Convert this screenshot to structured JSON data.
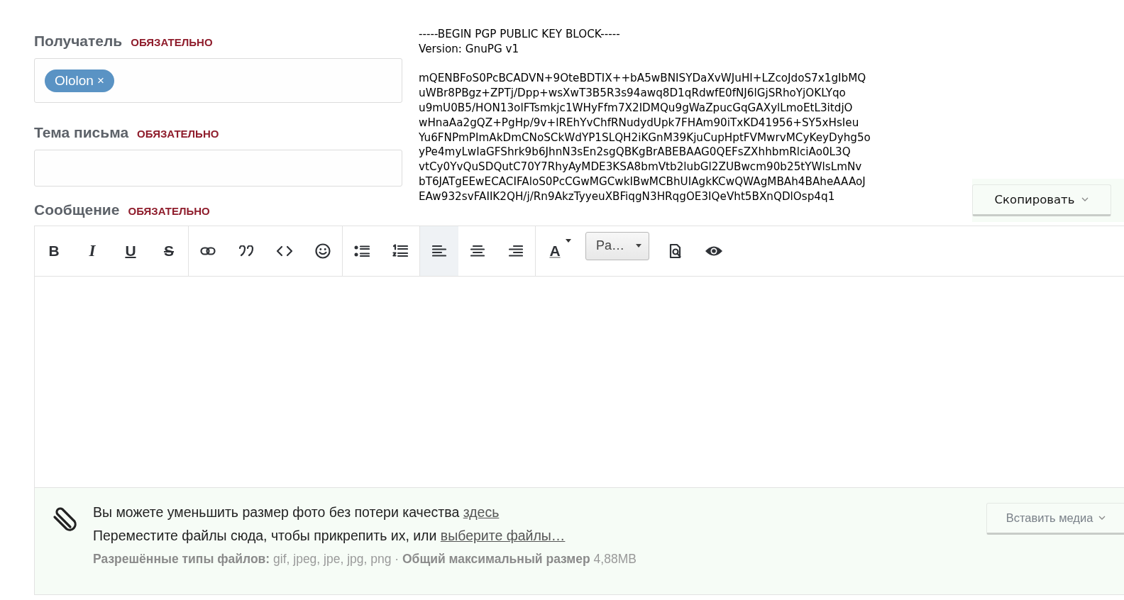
{
  "fields": [
    {
      "label": "Получатель",
      "required": "ОБЯЗАТЕЛЬНО",
      "kind": "tokens",
      "tokens": [
        {
          "name": "Ololon",
          "remove": "×"
        }
      ]
    },
    {
      "label": "Тема письма",
      "required": "ОБЯЗАТЕЛЬНО",
      "kind": "text"
    }
  ],
  "pgp": {
    "header": [
      "-----BEGIN PGP PUBLIC KEY BLOCK-----",
      "Version: GnuPG v1"
    ],
    "body": [
      "mQENBFoS0PcBCADVN+9OteBDTIX++bA5wBNISYDaXvWJuHI+LZcoJdoS7x1gIbMQ",
      "uWBr8PBgz+ZPTj/Dpp+wsXwT3B5R3s94awq8D1qRdwfE0fNJ6lGjSRhoYjOKLYqo",
      "u9mU0B5/HON13olFTsmkjc1WHyFfm7X2IDMQu9gWaZpucGqGAXylLmoEtL3itdjO",
      "wHnaAa2gQZ+PgHp/9v+lREhYvChfRNudydUpk7FHAm90iTxKD41956+SY5xHsIeu",
      "Yu6FNPmPImAkDmCNoSCkWdYP1SLQH2iKGnM39KjuCupHptFVMwrvMCyKeyDyhg5o",
      "yPe4myLwIaGFShrk9b6JhnN3sEn2sgQBKgBrABEBAAG0QEFsZXhhbmRlciAo0L3Q",
      "vtCy0YvQuSDQutC70Y7RhyAyMDE3KSA8bmVtb2lubGl2ZUBwcm90b25tYWlsLmNv",
      "bT6JATgEEwECACIFAloS0PcCGwMGCwkIBwMCBhUIAgkKCwQWAgMBAh4BAheAAAoJ",
      "EAw932svFAIIK2QH/j/Rn9AkzTyyeuXBFiqgN3HRqgOE3IQeVht5BXnQDlOsp4q1"
    ],
    "copy_button": "Скопировать"
  },
  "message": {
    "label": "Сообщение",
    "required": "ОБЯЗАТЕЛЬНО",
    "toolbar": [
      {
        "items": [
          {
            "kind": "bold",
            "glyph": "B",
            "selected": false
          },
          {
            "kind": "italic",
            "glyph": "I",
            "selected": false
          },
          {
            "kind": "underline",
            "glyph": "U",
            "selected": false
          },
          {
            "kind": "strike",
            "glyph": "S",
            "selected": false
          }
        ]
      },
      {
        "items": [
          {
            "kind": "link",
            "selected": false
          },
          {
            "kind": "quote",
            "selected": false
          },
          {
            "kind": "code",
            "selected": false
          },
          {
            "kind": "smilie",
            "selected": false
          }
        ]
      },
      {
        "items": [
          {
            "kind": "bullets",
            "selected": false
          },
          {
            "kind": "numbers",
            "selected": false
          }
        ]
      },
      {
        "items": [
          {
            "kind": "align-left",
            "selected": true
          },
          {
            "kind": "align-center",
            "selected": false
          },
          {
            "kind": "align-right",
            "selected": false
          }
        ]
      },
      {
        "items": [
          {
            "kind": "text-color",
            "glyph": "A",
            "selected": false
          },
          {
            "kind": "style",
            "label": "Pa…",
            "selected": false
          },
          {
            "kind": "preview",
            "selected": false
          },
          {
            "kind": "eye",
            "selected": false
          }
        ]
      }
    ]
  },
  "attachments": {
    "hint": "Вы можете уменьшить размер фото без потери качества",
    "hint_link": "здесь",
    "drop": "Переместите файлы сюда, чтобы прикрепить их, или",
    "drop_link": "выберите файлы…",
    "allowed": "**Разрешённые типы файлов:** gif, jpeg, jpe, jpg, png · **Общий максимальный размер** 4,88MB",
    "insert_button": "Вставить медиа"
  }
}
